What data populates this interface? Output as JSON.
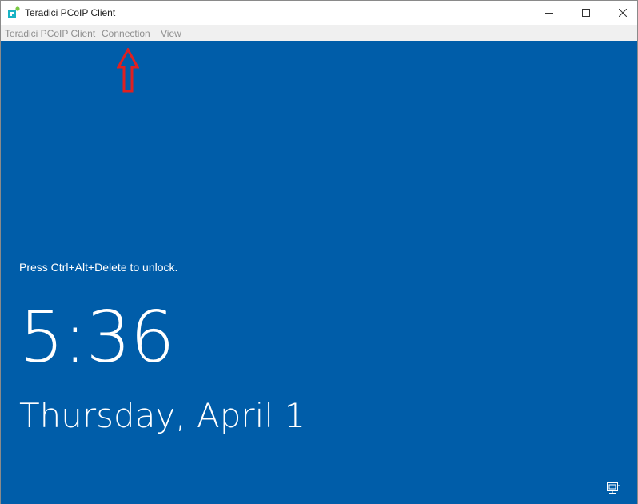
{
  "window": {
    "title": "Teradici PCoIP Client",
    "app_icon": "teradici-logo-icon",
    "controls": [
      "minimize-icon",
      "maximize-icon",
      "close-icon"
    ]
  },
  "menubar": {
    "items": [
      {
        "label": "Teradici PCoIP Client"
      },
      {
        "label": "Connection"
      },
      {
        "label": "View"
      }
    ]
  },
  "annotation": {
    "icon": "red-up-arrow-icon",
    "color": "#e02020"
  },
  "lockscreen": {
    "background": "#005da9",
    "prompt": "Press Ctrl+Alt+Delete to unlock.",
    "time": "5:36",
    "date": "Thursday, April 1",
    "network_icon": "network-monitor-icon"
  }
}
